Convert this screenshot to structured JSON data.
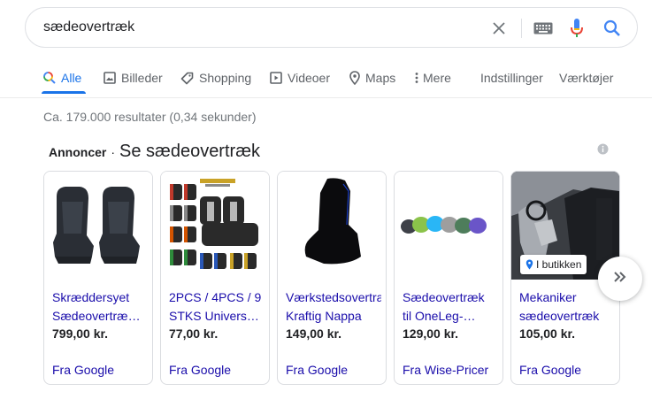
{
  "search": {
    "query": "sædeovertræk"
  },
  "tabs": [
    {
      "label": "Alle",
      "icon": "search-icon",
      "active": true
    },
    {
      "label": "Billeder",
      "icon": "image-icon"
    },
    {
      "label": "Shopping",
      "icon": "tag-icon"
    },
    {
      "label": "Videoer",
      "icon": "play-icon"
    },
    {
      "label": "Maps",
      "icon": "map-pin-icon"
    },
    {
      "label": "Mere",
      "icon": "more-vert-icon"
    },
    {
      "label": "Indstillinger"
    },
    {
      "label": "Værktøjer"
    }
  ],
  "result_stats": "Ca. 179.000 resultater (0,34 sekunder)",
  "ads": {
    "label": "Annoncer",
    "separator": "·",
    "title": "Se sædeovertræk"
  },
  "products": [
    {
      "title_line1": "Skræddersyet",
      "title_line2": "Sædeovertræ…",
      "price": "799,00 kr.",
      "seller": "Fra Google"
    },
    {
      "title_line1": "2PCS / 4PCS / 9",
      "title_line2": "STKS Univers…",
      "price": "77,00 kr.",
      "seller": "Fra Google"
    },
    {
      "title_line1": "Værkstedsovertræ",
      "title_line2": "Kraftig Nappa",
      "price": "149,00 kr.",
      "seller": "Fra Google"
    },
    {
      "title_line1": "Sædeovertræk",
      "title_line2": "til OneLeg-…",
      "price": "129,00 kr.",
      "seller": "Fra Wise-Pricer"
    },
    {
      "title_line1": "Mekaniker",
      "title_line2": "sædeovertræk",
      "price": "105,00 kr.",
      "seller": "Fra Google",
      "badge": "I butikken"
    }
  ],
  "colors": {
    "accent": "#1a73e8",
    "link": "#1a0dab",
    "muted": "#70757a"
  }
}
